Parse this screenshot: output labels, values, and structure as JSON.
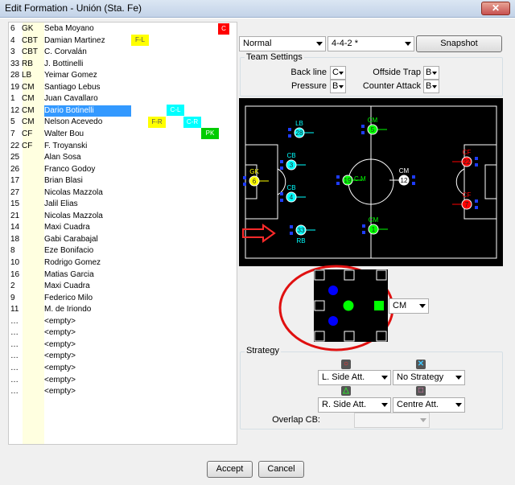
{
  "window": {
    "title": "Edit Formation - Unión (Sta. Fe)",
    "close_icon": "close-icon"
  },
  "players": [
    {
      "num": "6",
      "pos": "GK",
      "name": "Seba Moyano"
    },
    {
      "num": "4",
      "pos": "CBT",
      "name": "Damian Martinez"
    },
    {
      "num": "3",
      "pos": "CBT",
      "name": "C. Corvalán"
    },
    {
      "num": "33",
      "pos": "RB",
      "name": "J. Bottinelli"
    },
    {
      "num": "28",
      "pos": "LB",
      "name": "Yeimar Gomez"
    },
    {
      "num": "19",
      "pos": "CM",
      "name": "Santiago Lebus"
    },
    {
      "num": "1",
      "pos": "CM",
      "name": "Juan Cavallaro"
    },
    {
      "num": "12",
      "pos": "CM",
      "name": "Dario Botinelli"
    },
    {
      "num": "5",
      "pos": "CM",
      "name": "Nelson Acevedo"
    },
    {
      "num": "7",
      "pos": "CF",
      "name": "Walter Bou"
    },
    {
      "num": "22",
      "pos": "CF",
      "name": "F. Troyanski"
    },
    {
      "num": "25",
      "pos": "",
      "name": "Alan Sosa"
    },
    {
      "num": "26",
      "pos": "",
      "name": "Franco Godoy"
    },
    {
      "num": "17",
      "pos": "",
      "name": "Brian Blasi"
    },
    {
      "num": "27",
      "pos": "",
      "name": "Nicolas Mazzola"
    },
    {
      "num": "15",
      "pos": "",
      "name": "Jalil Elias"
    },
    {
      "num": "21",
      "pos": "",
      "name": "Nicolas Mazzola"
    },
    {
      "num": "14",
      "pos": "",
      "name": "Maxi Cuadra"
    },
    {
      "num": "18",
      "pos": "",
      "name": "Gabi Carabajal"
    },
    {
      "num": "8",
      "pos": "",
      "name": "Eze Bonifacio"
    },
    {
      "num": "10",
      "pos": "",
      "name": "Rodrigo Gomez"
    },
    {
      "num": "16",
      "pos": "",
      "name": "Matias Garcia"
    },
    {
      "num": "2",
      "pos": "",
      "name": "Maxi Cuadra"
    },
    {
      "num": "9",
      "pos": "",
      "name": "Federico Milo"
    },
    {
      "num": "11",
      "pos": "",
      "name": "M. de Iriondo"
    },
    {
      "num": "…",
      "pos": "",
      "name": "<empty>"
    },
    {
      "num": "…",
      "pos": "",
      "name": "<empty>"
    },
    {
      "num": "…",
      "pos": "",
      "name": "<empty>"
    },
    {
      "num": "…",
      "pos": "",
      "name": "<empty>"
    },
    {
      "num": "…",
      "pos": "",
      "name": "<empty>"
    },
    {
      "num": "…",
      "pos": "",
      "name": "<empty>"
    },
    {
      "num": "…",
      "pos": "",
      "name": "<empty>"
    }
  ],
  "selected_player_index": 7,
  "role_tags": {
    "captain": "C",
    "fk_left": "F-L",
    "ck_left": "C-L",
    "fk_right": "F-R",
    "ck_right": "C-R",
    "penalty": "PK"
  },
  "colors": {
    "captain": "#ff0000",
    "freekick": "#ffff00",
    "corner": "#00ffff",
    "penalty": "#00cc00",
    "selection": "#3399ff",
    "pitch": "#000000",
    "defender": "#00ffff",
    "midfielder": "#00ff00",
    "forward": "#ff0000",
    "keeper": "#ffff00",
    "annotation": "#ff0000"
  },
  "toolbar": {
    "mode": "Normal",
    "formation": "4-4-2 *",
    "snapshot": "Snapshot"
  },
  "team_settings": {
    "title": "Team Settings",
    "back_line_label": "Back line",
    "back_line_value": "C",
    "offside_trap_label": "Offside Trap",
    "offside_trap_value": "B",
    "pressure_label": "Pressure",
    "pressure_value": "B",
    "counter_attack_label": "Counter Attack",
    "counter_attack_value": "B"
  },
  "pitch_players": [
    {
      "num": "28",
      "pos": "LB"
    },
    {
      "num": "5",
      "pos": "CM"
    },
    {
      "num": "3",
      "pos": "CB"
    },
    {
      "num": "6",
      "pos": "GK"
    },
    {
      "num": "4",
      "pos": "CB"
    },
    {
      "num": "19",
      "pos": "C M"
    },
    {
      "num": "12",
      "pos": "CM"
    },
    {
      "num": "1",
      "pos": "CM"
    },
    {
      "num": "33",
      "pos": "RB"
    },
    {
      "num": "22",
      "pos": "CF"
    },
    {
      "num": "7",
      "pos": "CF"
    }
  ],
  "role_select": "CM",
  "strategy": {
    "title": "Strategy",
    "circle_option": "L. Side Att.",
    "cross_option": "No Strategy",
    "triangle_option": "R. Side Att.",
    "square_option": "Centre Att.",
    "overlap_label": "Overlap CB:",
    "overlap_value": ""
  },
  "footer": {
    "accept": "Accept",
    "cancel": "Cancel"
  }
}
